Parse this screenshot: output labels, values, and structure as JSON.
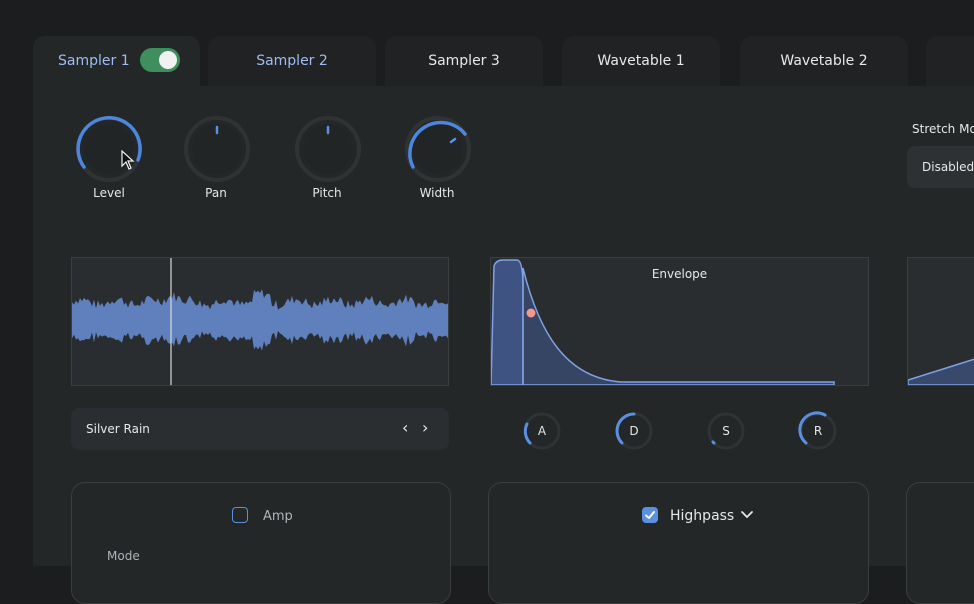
{
  "tabs": [
    {
      "label": "Sampler 1",
      "active": true
    },
    {
      "label": "Sampler 2"
    },
    {
      "label": "Sampler 3"
    },
    {
      "label": "Wavetable 1"
    },
    {
      "label": "Wavetable 2"
    }
  ],
  "sampler_toggle": {
    "on": true
  },
  "knobs": [
    {
      "label": "Level"
    },
    {
      "label": "Pan"
    },
    {
      "label": "Pitch"
    },
    {
      "label": "Width"
    }
  ],
  "stretch": {
    "label": "Stretch Mo",
    "value": "Disabled"
  },
  "envelope": {
    "title": "Envelope"
  },
  "sample": {
    "name": "Silver Rain",
    "prev": "‹",
    "next": "›"
  },
  "adsr": [
    {
      "label": "A"
    },
    {
      "label": "D"
    },
    {
      "label": "S"
    },
    {
      "label": "R"
    }
  ],
  "amp": {
    "label": "Amp",
    "checked": false,
    "mode_label": "Mode"
  },
  "filter": {
    "label": "Highpass",
    "checked": true
  },
  "colors": {
    "accent": "#5b8fe0",
    "toggle_on": "#3f8f5e",
    "playhead": "#d9d9d9",
    "env_point": "#f09a8e"
  }
}
